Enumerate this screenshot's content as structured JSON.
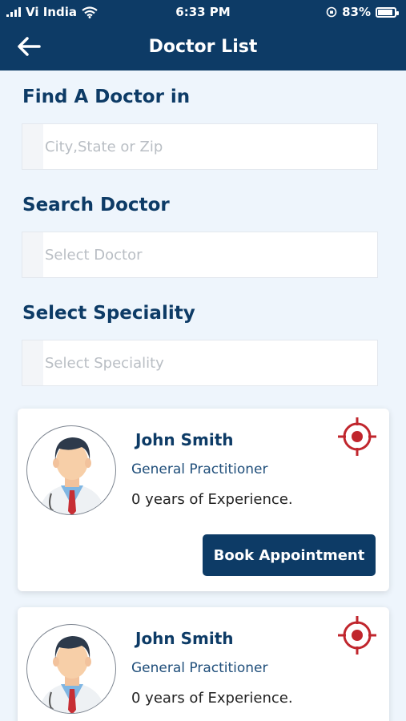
{
  "status_bar": {
    "carrier": "Vi India",
    "time": "6:33 PM",
    "battery": "83%"
  },
  "header": {
    "title": "Doctor List"
  },
  "search": {
    "location_label": "Find A Doctor in",
    "location_placeholder": "City,State or Zip",
    "doctor_label": "Search Doctor",
    "doctor_placeholder": "Select Doctor",
    "speciality_label": "Select Speciality",
    "speciality_placeholder": "Select Speciality"
  },
  "doctors": [
    {
      "name": "John Smith",
      "speciality": "General Practitioner",
      "experience": "0 years of Experience.",
      "button": "Book Appointment"
    },
    {
      "name": "John Smith",
      "speciality": "General Practitioner",
      "experience": "0 years of Experience."
    }
  ],
  "colors": {
    "primary": "#0d3b66",
    "background": "#eef5fc",
    "accent": "#c0262d"
  }
}
